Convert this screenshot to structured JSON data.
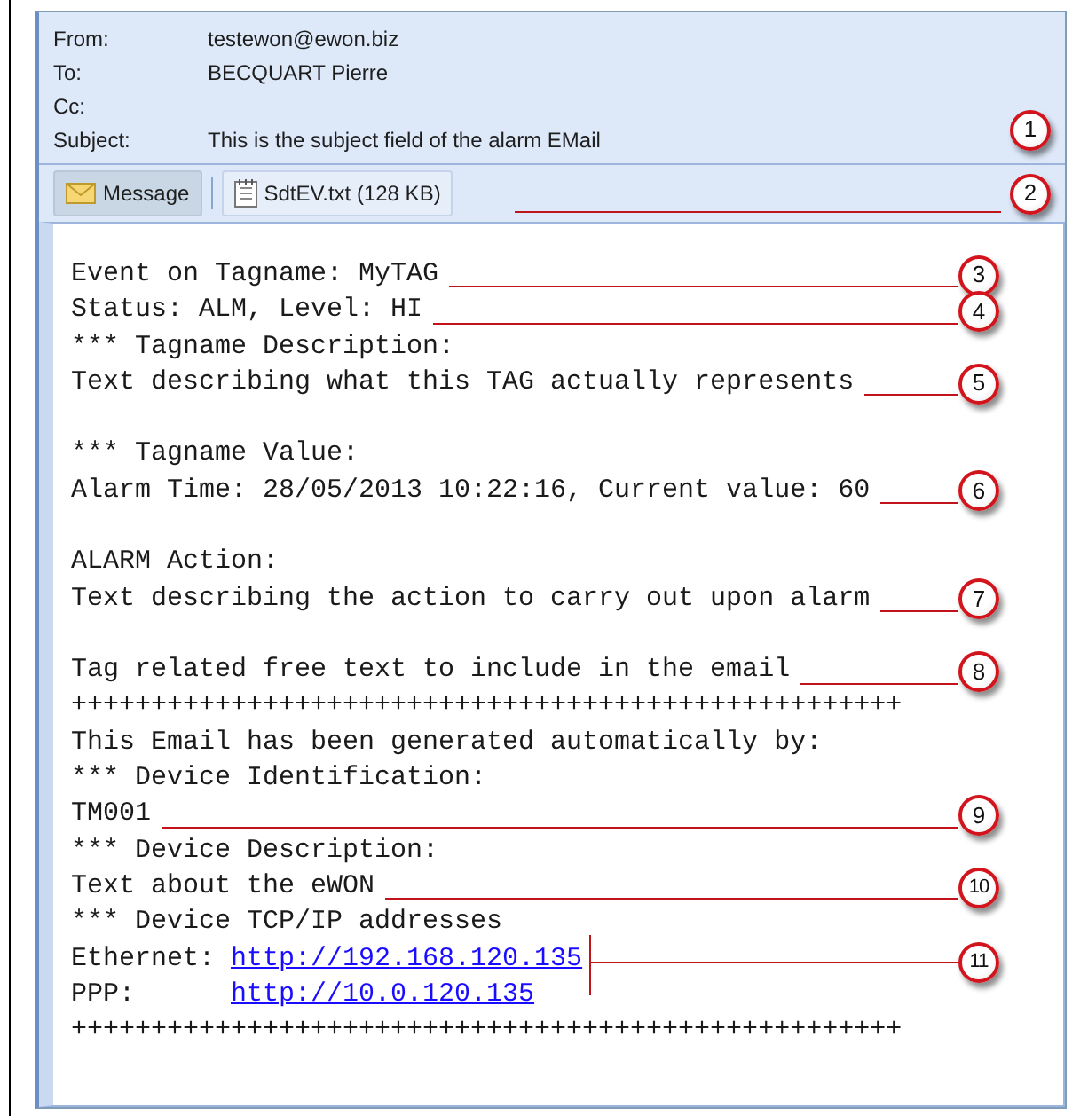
{
  "header": {
    "fields": [
      {
        "label": "From:",
        "value": "testewon@ewon.biz"
      },
      {
        "label": "To:",
        "value": "BECQUART Pierre"
      },
      {
        "label": "Cc:"
      },
      {
        "label": "Subject:",
        "value": "This is the subject field of the alarm EMail",
        "callout": "1"
      }
    ]
  },
  "attachments": {
    "items": [
      {
        "kind": "message",
        "label": "Message",
        "selected": true
      },
      {
        "kind": "file",
        "label": "SdtEV.txt (128 KB)",
        "selected": false
      }
    ],
    "callout": "2"
  },
  "body": {
    "lines": [
      {
        "kind": "text",
        "text": "Event on Tagname: MyTAG",
        "callout": "3"
      },
      {
        "kind": "text",
        "text": "Status: ALM, Level: HI",
        "callout": "4"
      },
      {
        "kind": "text",
        "text": "*** Tagname Description:"
      },
      {
        "kind": "text",
        "text": "Text describing what this TAG actually represents",
        "callout": "5"
      },
      {
        "kind": "blank"
      },
      {
        "kind": "text",
        "text": "*** Tagname Value:"
      },
      {
        "kind": "text",
        "text": "Alarm Time: 28/05/2013 10:22:16, Current value: 60",
        "callout": "6"
      },
      {
        "kind": "blank"
      },
      {
        "kind": "text",
        "text": "ALARM Action:"
      },
      {
        "kind": "text",
        "text": "Text describing the action to carry out upon alarm",
        "callout": "7"
      },
      {
        "kind": "blank"
      },
      {
        "kind": "text",
        "text": "Tag related free text to include in the email",
        "callout": "8"
      },
      {
        "kind": "text",
        "text": "++++++++++++++++++++++++++++++++++++++++++++++++++++"
      },
      {
        "kind": "text",
        "text": "This Email has been generated automatically by:"
      },
      {
        "kind": "text",
        "text": "*** Device Identification:"
      },
      {
        "kind": "text",
        "text": "TM001",
        "callout": "9"
      },
      {
        "kind": "text",
        "text": "*** Device Description:"
      },
      {
        "kind": "text",
        "text": "Text about the eWON",
        "callout": "10"
      },
      {
        "kind": "text",
        "text": "*** Device TCP/IP addresses"
      },
      {
        "kind": "addresses",
        "callout": "11",
        "rows": [
          {
            "label": "Ethernet:",
            "url": "http://192.168.120.135"
          },
          {
            "label": "PPP:",
            "url": "http://10.0.120.135"
          }
        ]
      },
      {
        "kind": "text",
        "text": "++++++++++++++++++++++++++++++++++++++++++++++++++++"
      }
    ]
  }
}
